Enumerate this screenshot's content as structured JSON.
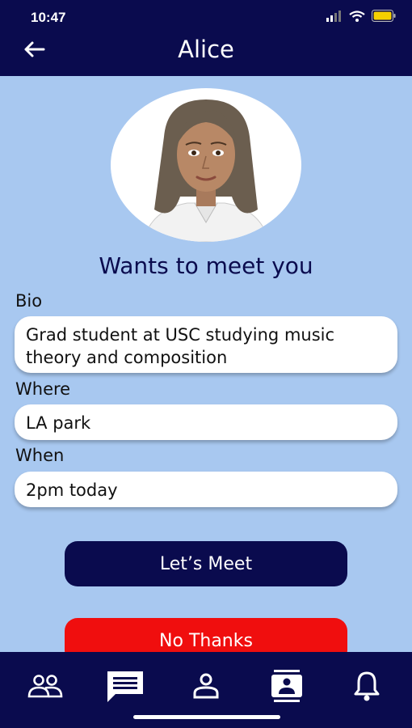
{
  "status_bar": {
    "time": "10:47"
  },
  "header": {
    "title": "Alice"
  },
  "headline": "Wants to meet you",
  "bio": {
    "label": "Bio",
    "value": "Grad student at USC studying music theory and composition"
  },
  "where": {
    "label": "Where",
    "value": "LA park"
  },
  "when": {
    "label": "When",
    "value": "2pm today"
  },
  "buttons": {
    "meet": "Let’s Meet",
    "decline": "No Thanks"
  },
  "tab_icons": [
    "people-icon",
    "chat-icon",
    "person-icon",
    "contacts-icon",
    "bell-icon"
  ],
  "colors": {
    "navy": "#0a0b4e",
    "background": "#a8c8f0",
    "decline": "#f00e0e"
  }
}
